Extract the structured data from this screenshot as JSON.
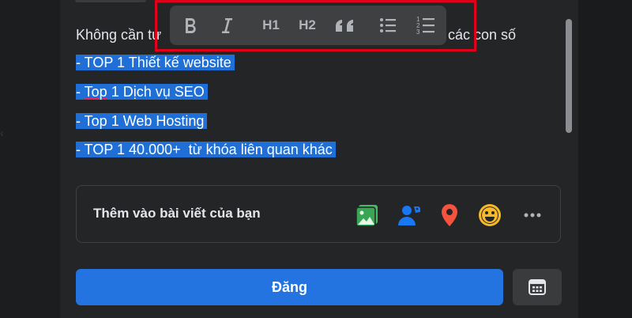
{
  "editor": {
    "intro_left": "Không cần tự",
    "intro_right": "các con số",
    "lines": [
      {
        "prefix": "- ",
        "underlined": "TOP",
        "rest": " 1 Thiết kế website"
      },
      {
        "prefix": "- ",
        "underlined": "Top",
        "rest": " 1 Dịch vụ SEO"
      },
      {
        "prefix": "- ",
        "underlined": "Top",
        "rest": " 1 Web Hosting"
      },
      {
        "prefix": "- ",
        "underlined": "TOP",
        "rest": " 1 40.000+  từ khóa liên quan khác"
      }
    ]
  },
  "format_toolbar": {
    "buttons": [
      {
        "name": "bold",
        "icon": "bold-icon"
      },
      {
        "name": "italic",
        "icon": "italic-icon"
      },
      {
        "name": "h1",
        "label": "H1"
      },
      {
        "name": "h2",
        "label": "H2"
      },
      {
        "name": "quote",
        "icon": "quote-icon"
      },
      {
        "name": "bulleted-list",
        "icon": "bulleted-list-icon"
      },
      {
        "name": "numbered-list",
        "icon": "numbered-list-icon"
      }
    ]
  },
  "add_to_post": {
    "label": "Thêm vào bài viết của bạn",
    "icons": [
      "photo-icon",
      "tag-people-icon",
      "location-icon",
      "feeling-icon",
      "more-icon"
    ],
    "colors": {
      "photo": "#45bd62",
      "tag": "#1877f2",
      "location": "#f5533d",
      "feeling": "#f7b928",
      "more": "#b0b3b8"
    }
  },
  "actions": {
    "post_label": "Đăng",
    "post_color": "#2374e1",
    "schedule_icon": "calendar-icon"
  },
  "annotation": {
    "highlight_color": "#e0001a"
  }
}
